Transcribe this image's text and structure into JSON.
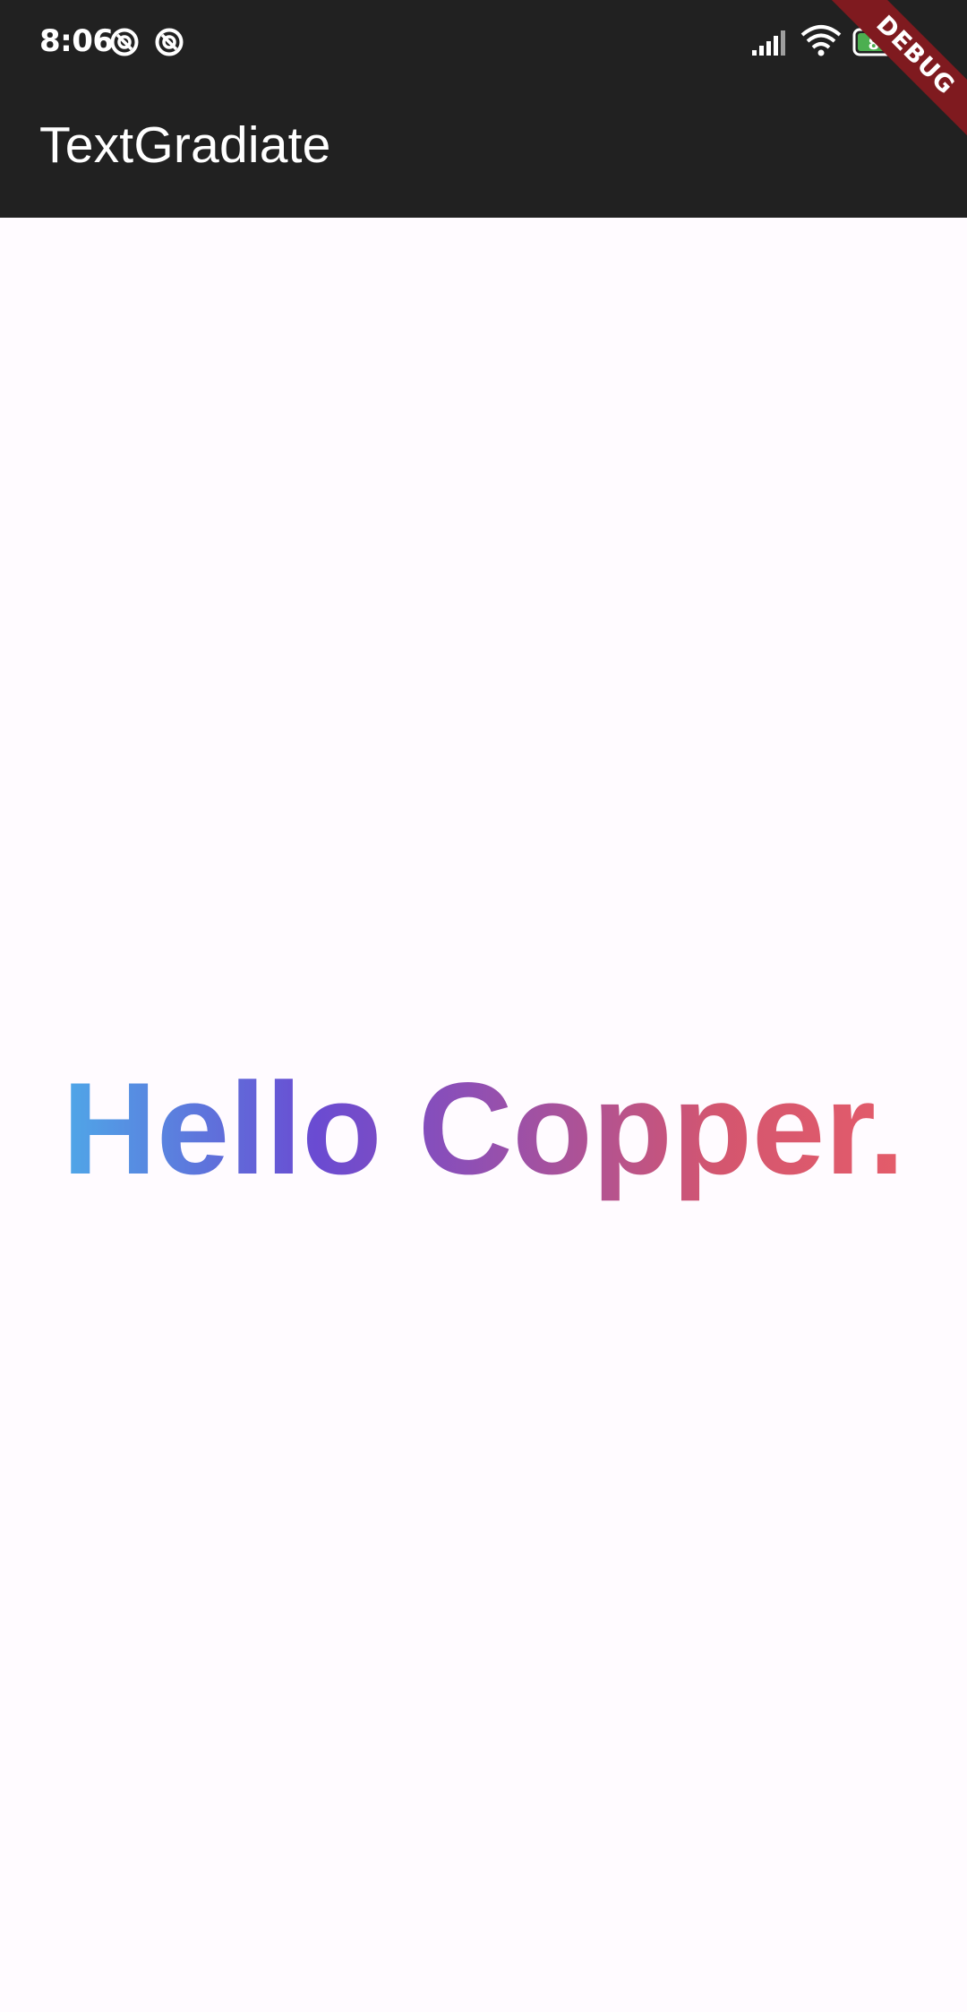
{
  "status_bar": {
    "time": "8:06",
    "battery_level": "87",
    "icons": [
      "notification-icon",
      "notification-icon",
      "signal-icon",
      "wifi-icon",
      "battery-icon"
    ]
  },
  "app_bar": {
    "title": "TextGradiate",
    "background_color": "#212121"
  },
  "debug_banner": {
    "label": "DEBUG",
    "color": "#7f1a1f"
  },
  "main": {
    "gradient_text": "Hello Copper.",
    "gradient_colors": [
      "#4fa8e8",
      "#6a4bd2",
      "#8e4fb5",
      "#d4566f",
      "#e45c6a"
    ],
    "background_color": "#fffbff"
  }
}
